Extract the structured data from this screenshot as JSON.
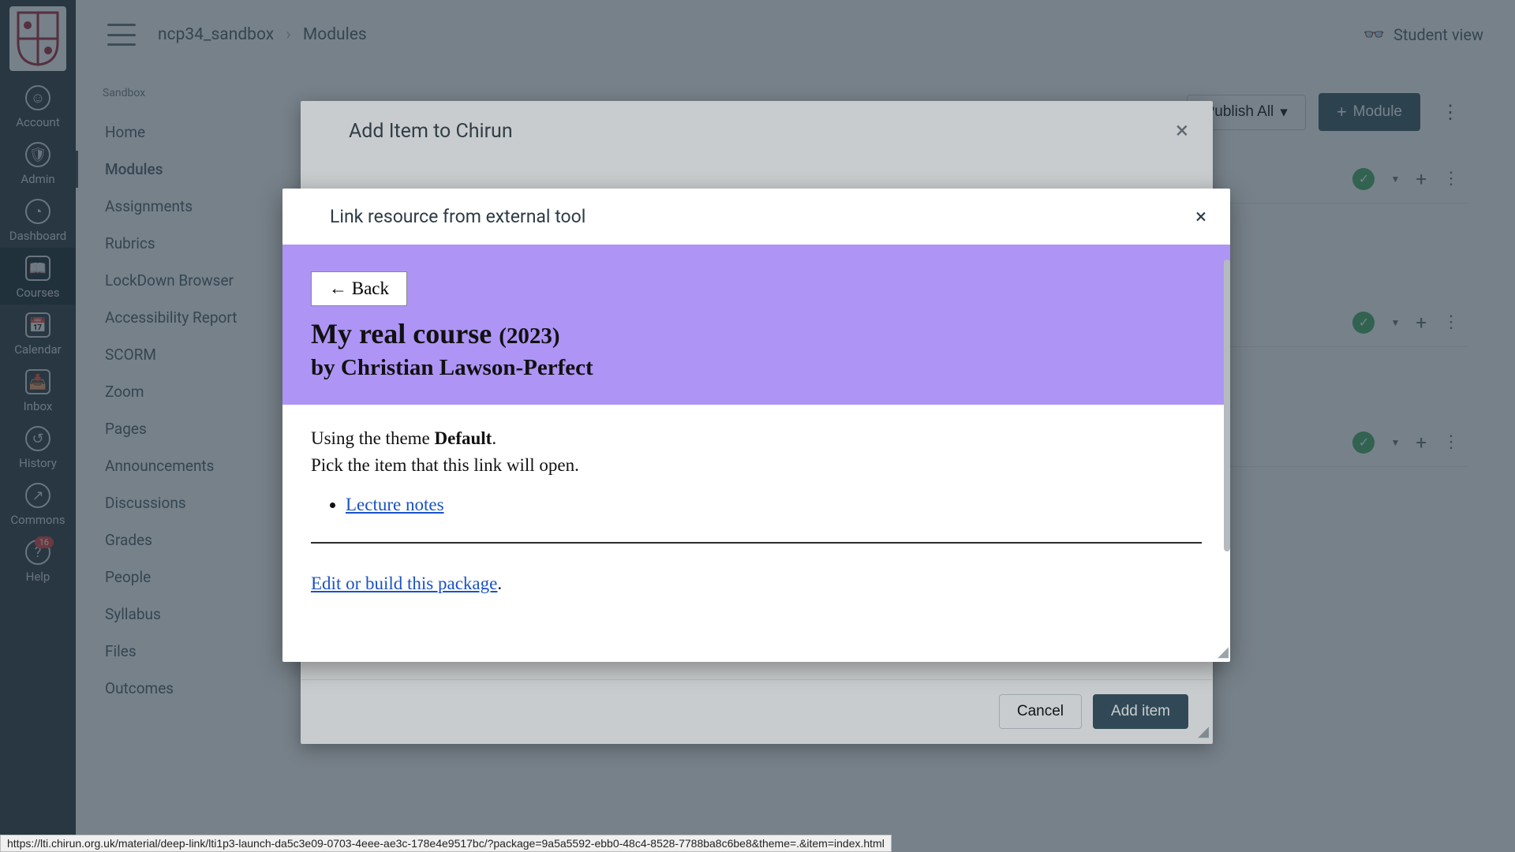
{
  "global_nav": {
    "items": [
      {
        "label": "Account",
        "icon": "user-icon"
      },
      {
        "label": "Admin",
        "icon": "shield-icon"
      },
      {
        "label": "Dashboard",
        "icon": "dashboard-icon"
      },
      {
        "label": "Courses",
        "icon": "book-icon"
      },
      {
        "label": "Calendar",
        "icon": "calendar-icon"
      },
      {
        "label": "Inbox",
        "icon": "inbox-icon"
      },
      {
        "label": "History",
        "icon": "history-icon"
      },
      {
        "label": "Commons",
        "icon": "commons-icon"
      },
      {
        "label": "Help",
        "icon": "help-icon",
        "badge": "16"
      }
    ]
  },
  "breadcrumb": {
    "course": "ncp34_sandbox",
    "page": "Modules"
  },
  "top_bar": {
    "student_view": "Student view"
  },
  "course_nav": {
    "label": "Sandbox",
    "items": [
      "Home",
      "Modules",
      "Assignments",
      "Rubrics",
      "LockDown Browser",
      "Accessibility Report",
      "SCORM",
      "Zoom",
      "Pages",
      "Announcements",
      "Discussions",
      "Grades",
      "People",
      "Syllabus",
      "Files",
      "Outcomes"
    ],
    "active_index": 1
  },
  "main_toolbar": {
    "publish_all": "Publish All",
    "add_module": "Module"
  },
  "outer_modal": {
    "title": "Add Item to Chirun",
    "cancel": "Cancel",
    "add_item": "Add item"
  },
  "inner_modal": {
    "title": "Link resource from external tool",
    "back": "← Back",
    "course_title": "My real course",
    "course_year": "(2023)",
    "author_prefix": "by",
    "author": "Christian Lawson-Perfect",
    "theme_prefix": "Using the theme",
    "theme_name": "Default",
    "pick_instruction": "Pick the item that this link will open.",
    "items": [
      "Lecture notes"
    ],
    "edit_link": "Edit or build this package"
  },
  "status_bar": {
    "url": "https://lti.chirun.org.uk/material/deep-link/lti1p3-launch-da5c3e09-0703-4eee-ae3c-178e4e9517bc/?package=9a5a5592-ebb0-48c4-8528-7788ba8c6be8&theme=.&item=index.html"
  }
}
